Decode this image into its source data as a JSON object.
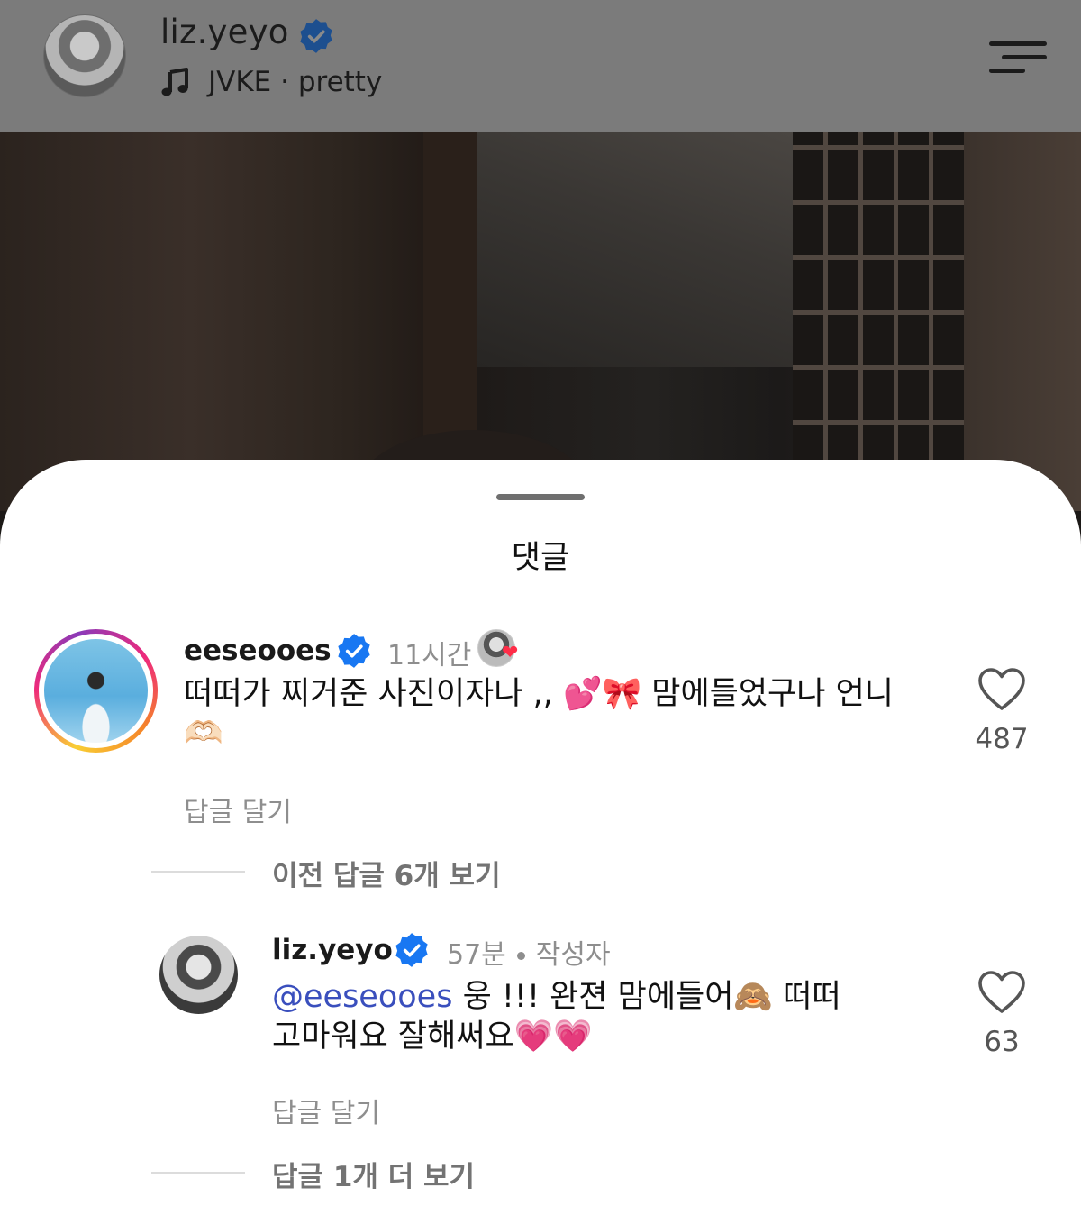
{
  "header": {
    "username": "liz.yeyo",
    "song_artist": "JVKE",
    "song_title": "pretty",
    "song_sep": " · "
  },
  "sheet": {
    "title": "댓글"
  },
  "comments": [
    {
      "username": "eeseooes",
      "verified": true,
      "time": "11시간",
      "text_line1": "떠떠가 찌거준 사진이자나 ,, 💕🎀 맘에들었구나 언니",
      "text_line2": "🫶🏻",
      "reply_label": "답글 달기",
      "likes": "487",
      "author_liked": true
    },
    {
      "username": "liz.yeyo",
      "verified": true,
      "time": "57분",
      "author_tag": "작성자",
      "mention": "@eeseooes",
      "text_line1_rest": " 웅 !!! 완젼 맘에들어🙈 떠떠",
      "text_line2": "고마워요 잘해써요💗💗",
      "reply_label": "답글 달기",
      "likes": "63"
    }
  ],
  "view_previous_replies": "이전 답글 6개 보기",
  "view_more_replies": "답글 1개 더 보기",
  "icons": {
    "verified": "verified-badge-icon",
    "music": "music-note-icon",
    "menu": "menu-icon",
    "like": "heart-outline-icon"
  },
  "colors": {
    "verified_blue": "#1877f2",
    "mention": "#3a4fbd",
    "muted_text": "#8e8e8e"
  }
}
